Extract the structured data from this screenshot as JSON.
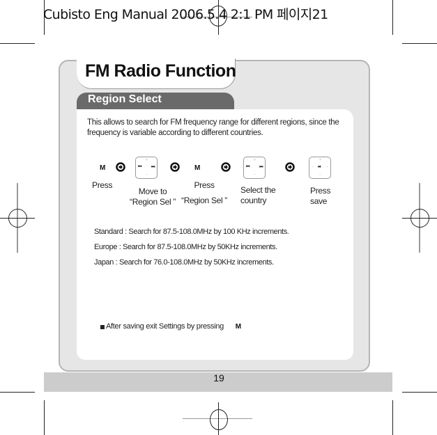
{
  "print_header": {
    "text": "Cubisto Eng Manual  2006.5.4 2:1 PM 페이지21"
  },
  "page": {
    "title": "FM Radio Function",
    "section": "Region Select",
    "intro": "This allows to search for FM frequency range for different regions, since the frequency is variable according to different countries."
  },
  "steps": [
    {
      "key": "M",
      "label_lines": [
        "Press"
      ]
    },
    {
      "control": "navigation-pad",
      "label_lines": [
        "Move to",
        "“Region Sel ”"
      ]
    },
    {
      "key": "M",
      "label_lines": [
        "Press",
        "“Region Sel ”"
      ]
    },
    {
      "control": "navigation-pad",
      "label_lines": [
        "Select the",
        "country"
      ]
    },
    {
      "control": "play-pad",
      "label_lines": [
        "Press",
        "save"
      ]
    }
  ],
  "pad_glyphs": {
    "prev": "⏮",
    "next": "⏭",
    "play": "⏯",
    "plus": "+",
    "minus": "−"
  },
  "regions": [
    "Standard : Search for 87.5-108.0MHz by 100 KHz increments.",
    "Europe : Search for 87.5-108.0MHz by 50KHz increments.",
    "Japan : Search for 76.0-108.0MHz by 50KHz increments."
  ],
  "note": {
    "text": "After saving exit Settings by pressing",
    "key": "M"
  },
  "footer": {
    "page_number": "19"
  },
  "colors": {
    "panel_bg": "#e6e6e6",
    "section_tab": "#6a6a6a",
    "footer_bar": "#cccccc"
  }
}
